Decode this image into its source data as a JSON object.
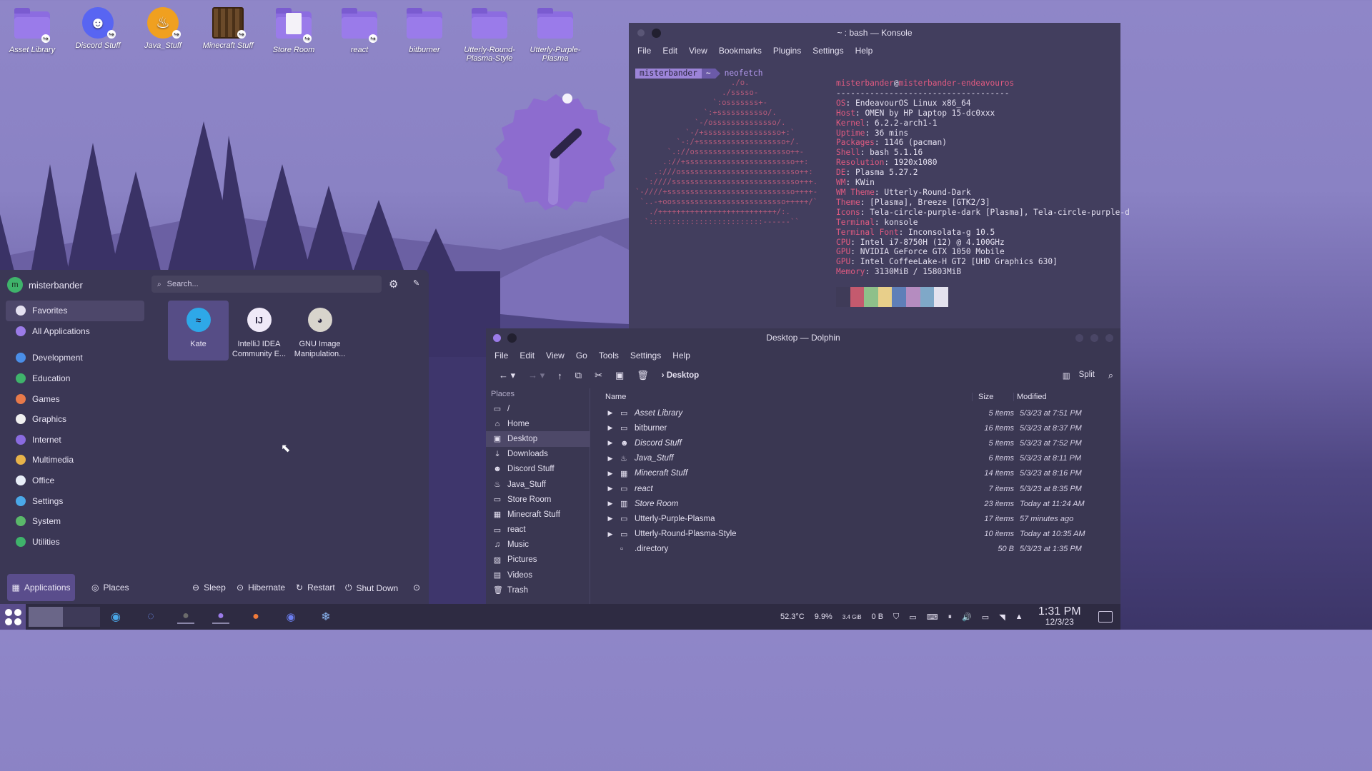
{
  "desktop_icons": [
    {
      "label": "Asset Library",
      "type": "folder",
      "link": true
    },
    {
      "label": "Discord Stuff",
      "type": "discord",
      "link": true
    },
    {
      "label": "Java_Stuff",
      "type": "java",
      "link": true
    },
    {
      "label": "Minecraft Stuff",
      "type": "minecraft",
      "link": true
    },
    {
      "label": "Store Room",
      "type": "store",
      "link": true
    },
    {
      "label": "react",
      "type": "folder",
      "link": true
    },
    {
      "label": "bitburner",
      "type": "folder",
      "link": false
    },
    {
      "label": "Utterly-Round-Plasma-Style",
      "type": "folder",
      "link": false
    },
    {
      "label": "Utterly-Purple-Plasma",
      "type": "folder",
      "link": false
    }
  ],
  "konsole": {
    "title": "~ : bash — Konsole",
    "menu": [
      "File",
      "Edit",
      "View",
      "Bookmarks",
      "Plugins",
      "Settings",
      "Help"
    ],
    "prompt_user": "misterbander",
    "prompt_dir": "~",
    "command": "neofetch",
    "user_host": {
      "user": "misterbander",
      "at": "@",
      "host": "misterbander-endeavouros"
    },
    "separator": "------------------------------------",
    "info": [
      {
        "k": "OS",
        "v": "EndeavourOS Linux x86_64"
      },
      {
        "k": "Host",
        "v": "OMEN by HP Laptop 15-dc0xxx"
      },
      {
        "k": "Kernel",
        "v": "6.2.2-arch1-1"
      },
      {
        "k": "Uptime",
        "v": "36 mins"
      },
      {
        "k": "Packages",
        "v": "1146 (pacman)"
      },
      {
        "k": "Shell",
        "v": "bash 5.1.16"
      },
      {
        "k": "Resolution",
        "v": "1920x1080"
      },
      {
        "k": "DE",
        "v": "Plasma 5.27.2"
      },
      {
        "k": "WM",
        "v": "KWin"
      },
      {
        "k": "WM Theme",
        "v": "Utterly-Round-Dark"
      },
      {
        "k": "Theme",
        "v": "[Plasma], Breeze [GTK2/3]"
      },
      {
        "k": "Icons",
        "v": "Tela-circle-purple-dark [Plasma], Tela-circle-purple-d"
      },
      {
        "k": "Terminal",
        "v": "konsole"
      },
      {
        "k": "Terminal Font",
        "v": "Inconsolata-g 10.5"
      },
      {
        "k": "CPU",
        "v": "Intel i7-8750H (12) @ 4.100GHz"
      },
      {
        "k": "GPU",
        "v": "NVIDIA GeForce GTX 1050 Mobile"
      },
      {
        "k": "GPU",
        "v": "Intel CoffeeLake-H GT2 [UHD Graphics 630]"
      },
      {
        "k": "Memory",
        "v": "3130MiB / 15803MiB"
      }
    ],
    "ascii": [
      "                     ./o.",
      "                   ./sssso-",
      "                 `:osssssss+-",
      "               `:+sssssssssso/.",
      "             `-/ossssssssssssso/.",
      "           `-/+sssssssssssssssso+:`",
      "         `-:/+sssssssssssssssssso+/.",
      "       `.://osssssssssssssssssssso++-",
      "      .://+ssssssssssssssssssssssso++:",
      "    .:///ossssssssssssssssssssssssso++:",
      "  `:////ssssssssssssssssssssssssssso+++.",
      "`-////+ssssssssssssssssssssssssssso++++-",
      " `..-+oosssssssssssssssssssssssso+++++/`",
      "   ./++++++++++++++++++++++++++/:.",
      "  `:::::::::::::::::::::::::------``"
    ],
    "palette": [
      "#3f3b58",
      "#c45a6e",
      "#8ec08a",
      "#e8cf8a",
      "#5f7fb8",
      "#b58cc0",
      "#7fa8c8",
      "#e4e2ee"
    ]
  },
  "launcher": {
    "user": "misterbander",
    "avatar_letter": "m",
    "search_placeholder": "Search...",
    "categories": [
      {
        "label": "Favorites",
        "color": "#e4e0f0",
        "icon": "bookmark-icon"
      },
      {
        "label": "All Applications",
        "color": "#9b7be8",
        "icon": "grid-icon"
      },
      {
        "label": "Development",
        "color": "#4a8ee8",
        "icon": "dev-icon"
      },
      {
        "label": "Education",
        "color": "#3fb36b",
        "icon": "edu-icon"
      },
      {
        "label": "Games",
        "color": "#e87a4a",
        "icon": "games-icon"
      },
      {
        "label": "Graphics",
        "color": "#f0f0f0",
        "icon": "graphics-icon"
      },
      {
        "label": "Internet",
        "color": "#8a6be0",
        "icon": "internet-icon"
      },
      {
        "label": "Multimedia",
        "color": "#e8b34a",
        "icon": "multimedia-icon"
      },
      {
        "label": "Office",
        "color": "#e8eef8",
        "icon": "office-icon"
      },
      {
        "label": "Settings",
        "color": "#4aa8e8",
        "icon": "settings-icon"
      },
      {
        "label": "System",
        "color": "#5ab86a",
        "icon": "system-icon"
      },
      {
        "label": "Utilities",
        "color": "#3fb36b",
        "icon": "utilities-icon"
      }
    ],
    "apps": [
      {
        "label": "Kate",
        "color": "#2ea8e8",
        "glyph": "≈"
      },
      {
        "label": "IntelliJ IDEA Community E...",
        "color": "#efe9f8",
        "glyph": "IJ"
      },
      {
        "label": "GNU Image Manipulation...",
        "color": "#d8d4cc",
        "glyph": "◕"
      }
    ],
    "bottom_tabs": [
      "Applications",
      "Places"
    ],
    "power": [
      "Sleep",
      "Hibernate",
      "Restart",
      "Shut Down"
    ]
  },
  "dolphin": {
    "title": "Desktop — Dolphin",
    "menu": [
      "File",
      "Edit",
      "View",
      "Go",
      "Tools",
      "Settings",
      "Help"
    ],
    "breadcrumb": "Desktop",
    "split_label": "Split",
    "places_header": "Places",
    "places": [
      {
        "label": "/",
        "icon": "folder-icon"
      },
      {
        "label": "Home",
        "icon": "home-icon"
      },
      {
        "label": "Desktop",
        "icon": "desktop-icon",
        "active": true
      },
      {
        "label": "Downloads",
        "icon": "download-icon"
      },
      {
        "label": "Discord Stuff",
        "icon": "discord-icon"
      },
      {
        "label": "Java_Stuff",
        "icon": "java-icon"
      },
      {
        "label": "Store Room",
        "icon": "folder-icon"
      },
      {
        "label": "Minecraft Stuff",
        "icon": "minecraft-icon"
      },
      {
        "label": "react",
        "icon": "folder-icon"
      },
      {
        "label": "Music",
        "icon": "music-icon"
      },
      {
        "label": "Pictures",
        "icon": "pictures-icon"
      },
      {
        "label": "Videos",
        "icon": "videos-icon"
      },
      {
        "label": "Trash",
        "icon": "trash-icon"
      }
    ],
    "columns": {
      "name": "Name",
      "size": "Size",
      "modified": "Modified"
    },
    "files": [
      {
        "name": "Asset Library",
        "size": "5 items",
        "modified": "5/3/23 at 7:51 PM",
        "italic": true,
        "icon": "folder-icon"
      },
      {
        "name": "bitburner",
        "size": "16 items",
        "modified": "5/3/23 at 8:37 PM",
        "italic": false,
        "icon": "folder-icon"
      },
      {
        "name": "Discord Stuff",
        "size": "5 items",
        "modified": "5/3/23 at 7:52 PM",
        "italic": true,
        "icon": "discord-icon"
      },
      {
        "name": "Java_Stuff",
        "size": "6 items",
        "modified": "5/3/23 at 8:11 PM",
        "italic": true,
        "icon": "java-icon"
      },
      {
        "name": "Minecraft Stuff",
        "size": "14 items",
        "modified": "5/3/23 at 8:16 PM",
        "italic": true,
        "icon": "minecraft-icon"
      },
      {
        "name": "react",
        "size": "7 items",
        "modified": "5/3/23 at 8:35 PM",
        "italic": true,
        "icon": "folder-icon"
      },
      {
        "name": "Store Room",
        "size": "23 items",
        "modified": "Today at 11:24 AM",
        "italic": true,
        "icon": "store-icon"
      },
      {
        "name": "Utterly-Purple-Plasma",
        "size": "17 items",
        "modified": "57 minutes ago",
        "italic": false,
        "icon": "folder-icon"
      },
      {
        "name": "Utterly-Round-Plasma-Style",
        "size": "10 items",
        "modified": "Today at 10:35 AM",
        "italic": false,
        "icon": "folder-icon"
      },
      {
        "name": ".directory",
        "size": "50 B",
        "modified": "5/3/23 at 1:35 PM",
        "italic": false,
        "icon": "file-icon"
      }
    ]
  },
  "tray": {
    "temp": "52.3°C",
    "cpu": "9.9%",
    "mem": "3.4 GiB",
    "net": "0 B",
    "time": "1:31 PM",
    "date": "12/3/23"
  }
}
